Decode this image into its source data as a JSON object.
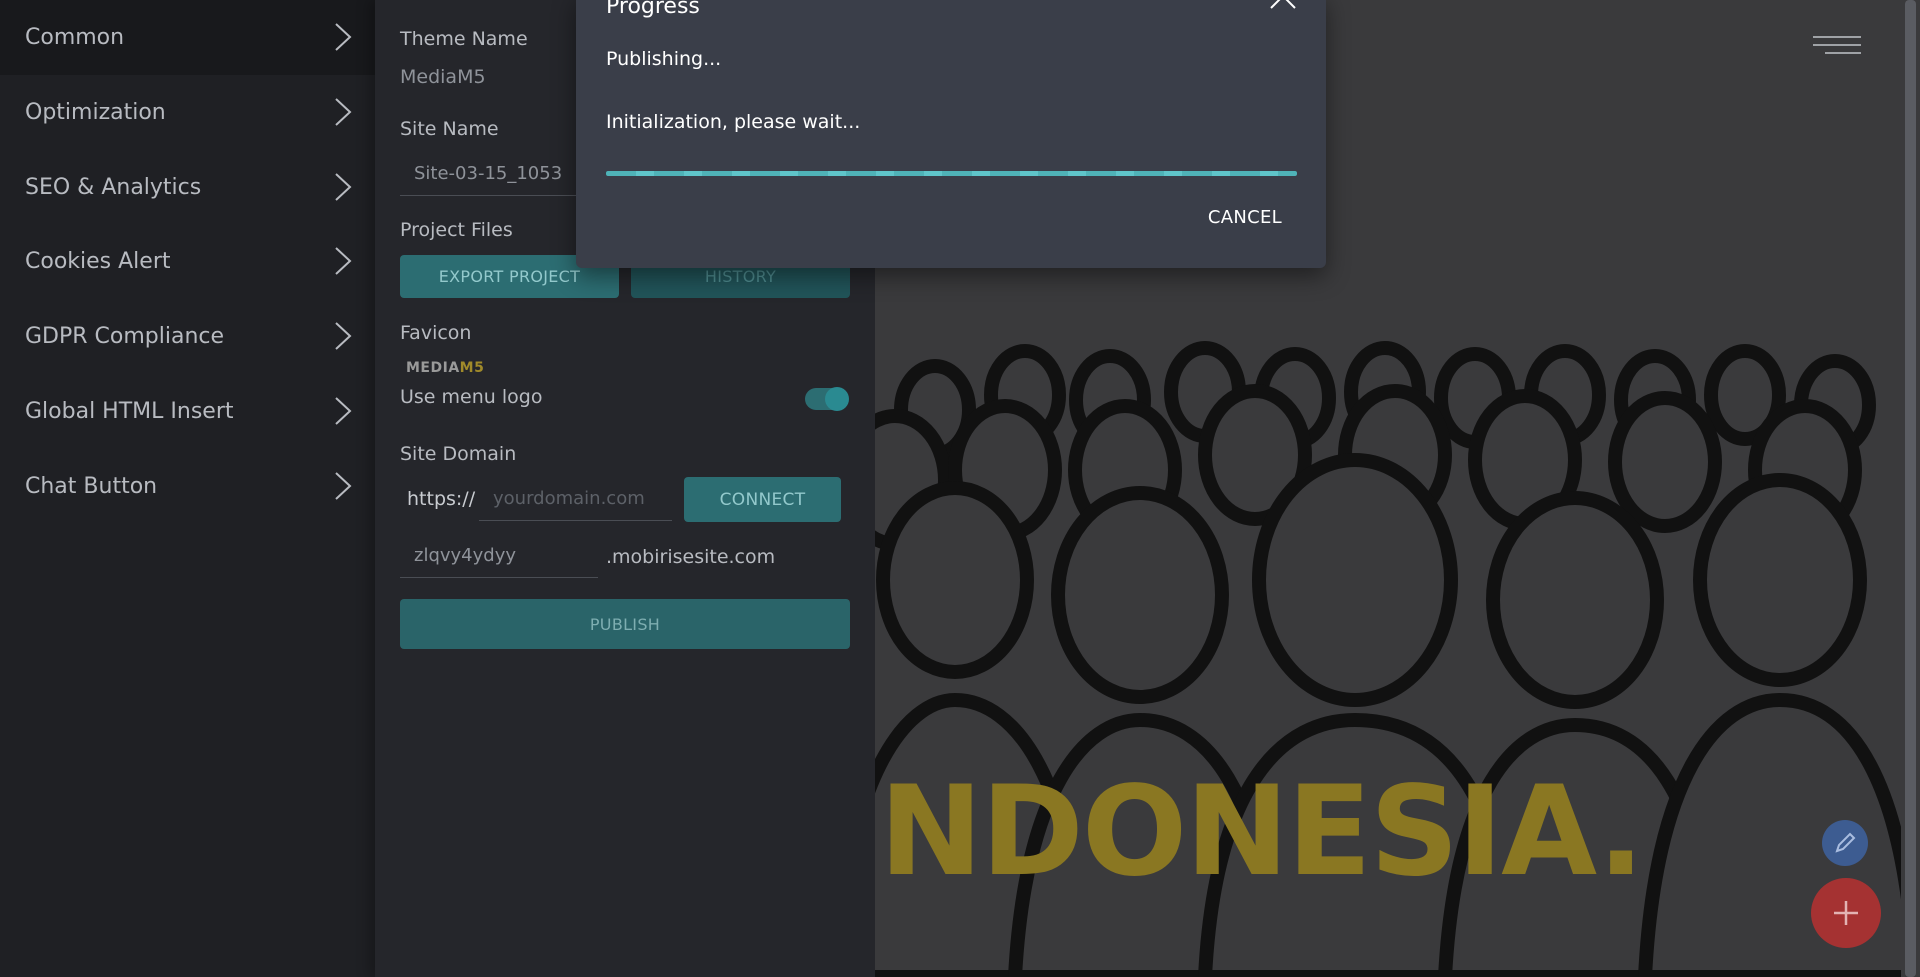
{
  "side_menu": {
    "items": [
      {
        "label": "Common"
      },
      {
        "label": "Optimization"
      },
      {
        "label": "SEO & Analytics"
      },
      {
        "label": "Cookies Alert"
      },
      {
        "label": "GDPR Compliance"
      },
      {
        "label": "Global HTML Insert"
      },
      {
        "label": "Chat Button"
      }
    ]
  },
  "settings": {
    "theme_name_label": "Theme Name",
    "theme_name_value": "MediaM5",
    "site_name_label": "Site Name",
    "site_name_value": "Site-03-15_1053",
    "project_files_label": "Project Files",
    "export_button": "EXPORT PROJECT",
    "history_button": "HISTORY",
    "favicon_label": "Favicon",
    "favicon_logo_a": "MEDIA",
    "favicon_logo_b": "M5",
    "use_menu_logo_label": "Use menu logo",
    "use_menu_logo_on": true,
    "site_domain_label": "Site Domain",
    "domain_prefix": "https://",
    "domain_placeholder": "yourdomain.com",
    "connect_button": "CONNECT",
    "subdomain_value": "zlqvy4ydyy",
    "subdomain_suffix": ".mobirisesite.com",
    "publish_button": "PUBLISH"
  },
  "preview": {
    "hero_text": "INDONESIA."
  },
  "dialog": {
    "title": "Progress",
    "message_1": "Publishing...",
    "message_2": "Initialization, please wait...",
    "progress_percent": 100,
    "cancel_label": "CANCEL"
  },
  "colors": {
    "accent": "#2c6d72",
    "hero_gold": "#8a7722",
    "fab_red": "#a53232",
    "fab_blue": "#3d5c91"
  }
}
